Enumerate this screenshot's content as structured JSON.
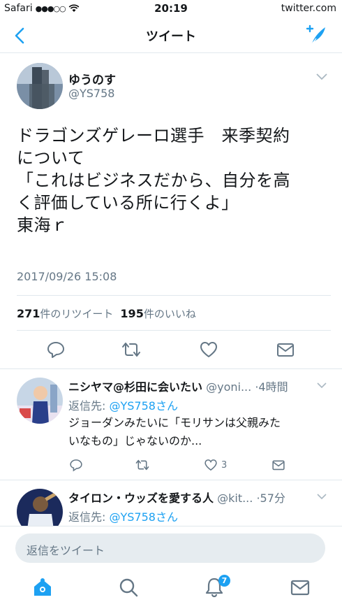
{
  "status_bar": {
    "carrier": "Safari",
    "signal": "●●●○○",
    "time": "20:19",
    "url": "twitter.com"
  },
  "nav": {
    "title": "ツイート",
    "back_icon": "chevron-left-icon",
    "compose_icon": "compose-tweet-icon"
  },
  "tweet": {
    "display_name": "ゆうのす",
    "handle": "@YS758",
    "text_lines": [
      "ドラゴンズゲレーロ選手　来季契約",
      "について",
      "「これはビジネスだから、自分を高",
      "く評価している所に行くよ」",
      "東海ｒ"
    ],
    "date": "2017/09/26 15:08",
    "retweet_count": "271",
    "retweet_label": "件のリツイート",
    "like_count": "195",
    "like_label": "件のいいね"
  },
  "replies": [
    {
      "name": "ニシヤマ@杉田に会いたい",
      "handle": "@yoni...",
      "time": "·4時間",
      "reply_to_label": "返信先: ",
      "reply_to_user": "@YS758さん",
      "body_lines": [
        "ジョーダンみたいに「モリサンは父親みた",
        "いなもの」じゃないのか..."
      ],
      "like_count": "3"
    },
    {
      "name": "タイロン・ウッズを愛する人",
      "handle": "@kit...",
      "time": "·57分",
      "reply_to_label": "返信先: ",
      "reply_to_user": "@YS758さん"
    }
  ],
  "compose": {
    "placeholder": "返信をツイート"
  },
  "tabs": {
    "notification_badge": "7"
  },
  "colors": {
    "accent": "#1da1f2",
    "secondary_text": "#657786",
    "divider": "#e1e8ed"
  }
}
